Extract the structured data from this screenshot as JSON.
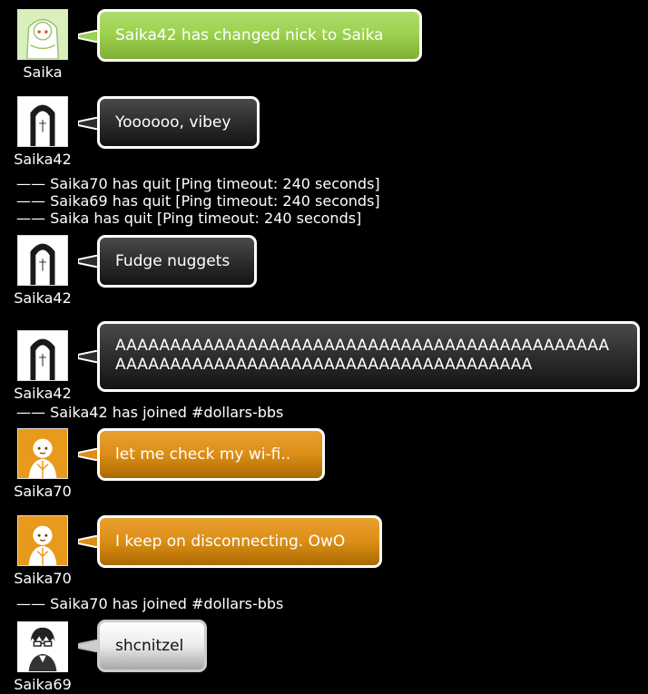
{
  "messages": [
    {
      "nick": "Saika",
      "text": "Saika42 has changed nick to Saika",
      "theme": "green",
      "avatar": "saika-green-avatar-icon"
    },
    {
      "nick": "Saika42",
      "text": "Yoooooo, vibey",
      "theme": "black",
      "avatar": "saika-black-avatar-icon"
    },
    {
      "nick": "Saika42",
      "text": "Fudge nuggets",
      "theme": "black",
      "avatar": "saika-black-avatar-icon"
    },
    {
      "nick": "Saika42",
      "text": "AAAAAAAAAAAAAAAAAAAAAAAAAAAAAAAAAAAAAAAAAAAAAAAAAAAAAAAAAAAAAAAAAAAAAAAAAAAAAAAAAAA",
      "theme": "black",
      "avatar": "saika-black-avatar-icon"
    },
    {
      "nick": "Saika70",
      "text": "let me check my wi-fi..",
      "theme": "orange",
      "avatar": "orange-avatar-icon"
    },
    {
      "nick": "Saika70",
      "text": "I keep on disconnecting. OwO",
      "theme": "orange",
      "avatar": "orange-avatar-icon"
    },
    {
      "nick": "Saika69",
      "text": "shcnitzel",
      "theme": "white",
      "avatar": "glasses-avatar-icon"
    }
  ],
  "system": [
    "—— Saika70 has quit [Ping timeout: 240 seconds]",
    "—— Saika69 has quit [Ping timeout: 240 seconds]",
    "—— Saika has quit [Ping timeout: 240 seconds]",
    "—— Saika42 has joined #dollars-bbs",
    "—— Saika70 has joined #dollars-bbs"
  ],
  "colors": {
    "green": "#9bd14e",
    "black": "#2d2d2d",
    "orange": "#dc8e16",
    "white": "#eaeaea"
  }
}
